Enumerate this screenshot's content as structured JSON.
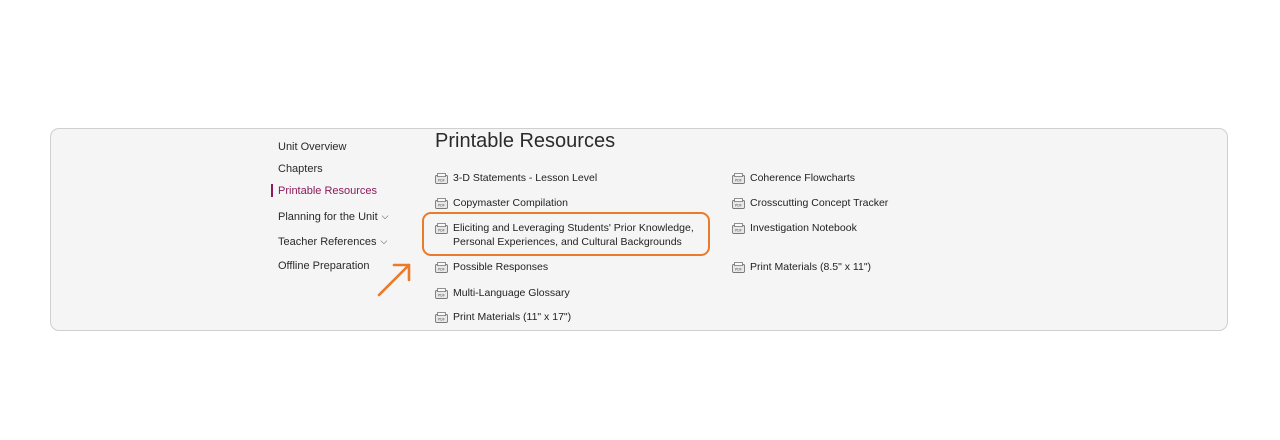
{
  "sidebar": {
    "items": [
      {
        "label": "Unit Overview"
      },
      {
        "label": "Chapters"
      },
      {
        "label": "Printable Resources"
      },
      {
        "label": "Planning for the Unit"
      },
      {
        "label": "Teacher References"
      },
      {
        "label": "Offline Preparation"
      }
    ]
  },
  "page_title": "Printable Resources",
  "resources": {
    "left": [
      {
        "label": "3-D Statements - Lesson Level"
      },
      {
        "label": "Copymaster Compilation"
      },
      {
        "label_line1": "Eliciting and Leveraging Students' Prior Knowledge,",
        "label_line2": "Personal Experiences, and Cultural Backgrounds"
      },
      {
        "label": "Possible Responses"
      },
      {
        "label": "Multi-Language Glossary"
      },
      {
        "label": "Print Materials (11\" x 17\")"
      }
    ],
    "right": [
      {
        "label": "Coherence Flowcharts"
      },
      {
        "label": "Crosscutting Concept Tracker"
      },
      {
        "label": "Investigation Notebook"
      },
      {
        "label": "Print Materials (8.5\" x 11\")"
      }
    ]
  },
  "icons": {
    "resource": "pdf-icon",
    "annotation": "arrow-icon"
  },
  "colors": {
    "active": "#8a1b5c",
    "annotation": "#ea7a2c",
    "panel_bg": "#f5f5f5"
  }
}
